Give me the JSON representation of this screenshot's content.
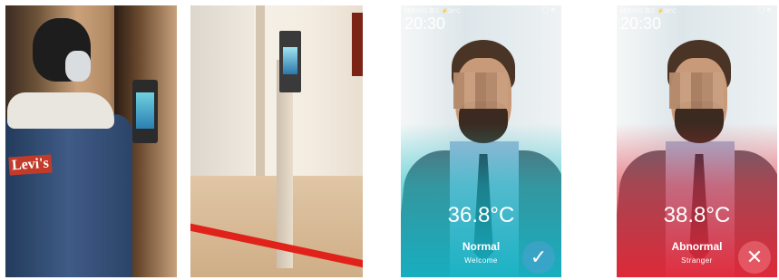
{
  "screens": [
    {
      "status_left": "06月19日 周三  ⚡26°C",
      "status_right": "◯ ≋",
      "time": "20:30",
      "temperature": "36.8°C",
      "status": "Normal",
      "message": "Welcome",
      "badge_icon": "✓",
      "tint_color": "#14b2c4"
    },
    {
      "status_left": "06月19日 周三  ⚡26°C",
      "status_right": "◯ ≋",
      "time": "20:30",
      "temperature": "38.8°C",
      "status": "Abnormal",
      "message": "Stranger",
      "badge_icon": "✕",
      "tint_color": "#e42636"
    }
  ],
  "photo1": {
    "jacket_logo": "Levi's"
  }
}
